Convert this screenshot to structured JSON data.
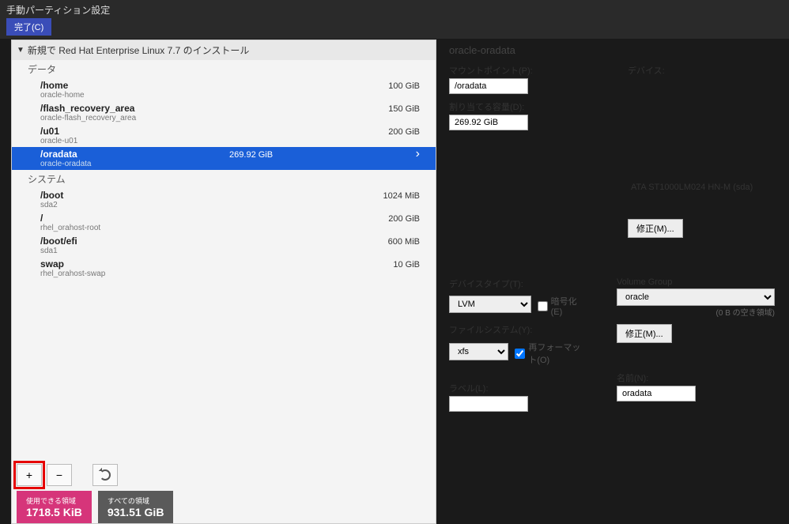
{
  "header": {
    "title": "手動パーティション設定",
    "done": "完了(C)"
  },
  "install_header": "新規で Red Hat Enterprise Linux 7.7 のインストール",
  "sections": {
    "data": "データ",
    "system": "システム"
  },
  "partitions_data": [
    {
      "mount": "/home",
      "device": "oracle-home",
      "size": "100 GiB"
    },
    {
      "mount": "/flash_recovery_area",
      "device": "oracle-flash_recovery_area",
      "size": "150 GiB"
    },
    {
      "mount": "/u01",
      "device": "oracle-u01",
      "size": "200 GiB"
    },
    {
      "mount": "/oradata",
      "device": "oracle-oradata",
      "size": "269.92 GiB"
    }
  ],
  "partitions_system": [
    {
      "mount": "/boot",
      "device": "sda2",
      "size": "1024 MiB"
    },
    {
      "mount": "/",
      "device": "rhel_orahost-root",
      "size": "200 GiB"
    },
    {
      "mount": "/boot/efi",
      "device": "sda1",
      "size": "600 MiB"
    },
    {
      "mount": "swap",
      "device": "rhel_orahost-swap",
      "size": "10 GiB"
    }
  ],
  "space": {
    "avail_label": "使用できる領域",
    "avail_value": "1718.5 KiB",
    "total_label": "すべての領域",
    "total_value": "931.51 GiB"
  },
  "details": {
    "title": "oracle-oradata",
    "mountpoint_label": "マウントポイント(P):",
    "mountpoint_value": "/oradata",
    "capacity_label": "割り当てる容量(D):",
    "capacity_value": "269.92 GiB",
    "devices_label": "デバイス:",
    "device_name": "ATA ST1000LM024 HN-M (sda)",
    "modify": "修正(M)...",
    "devtype_label": "デバイスタイプ(T):",
    "devtype_value": "LVM",
    "encrypt": "暗号化(E)",
    "fs_label": "ファイルシステム(Y):",
    "fs_value": "xfs",
    "reformat": "再フォーマット(O)",
    "vg_label": "Volume Group",
    "vg_value": "oracle",
    "vg_free": "(0 B の空き領域)",
    "label_label": "ラベル(L):",
    "label_value": "",
    "name_label": "名前(N):",
    "name_value": "oradata"
  }
}
